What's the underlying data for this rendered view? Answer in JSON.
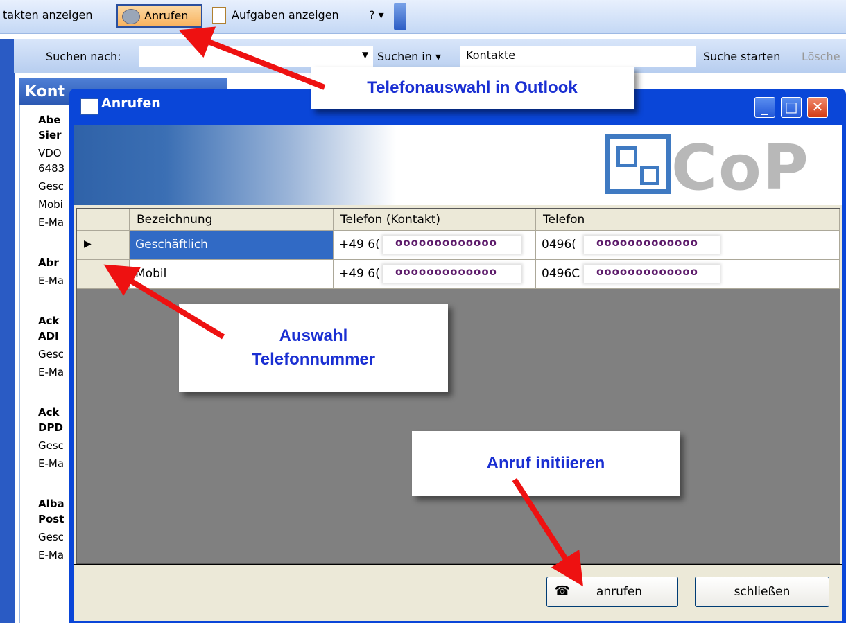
{
  "toolbar": {
    "show_contacts": "takten anzeigen",
    "call": "Anrufen",
    "show_tasks": "Aufgaben anzeigen",
    "help": "?"
  },
  "search": {
    "label": "Suchen nach:",
    "search_in": "Suchen in",
    "scope": "Kontakte",
    "start": "Suche starten",
    "clear": "Lösche"
  },
  "contacts": {
    "header": "Kont",
    "entries": [
      {
        "l1": "Abe",
        "l2": "Sier",
        "l3": "VDO",
        "l4": "6483",
        "l5": "Gesc",
        "l6": "Mobi",
        "l7": "E-Ma"
      },
      {
        "l1": "Abr",
        "l2": "E-Ma"
      },
      {
        "l1": "Ack",
        "l2": "ADI",
        "l3": "Gesc",
        "l4": "E-Ma"
      },
      {
        "l1": "Ack",
        "l2": "DPD",
        "l3": "Gesc",
        "l4": "E-Ma"
      },
      {
        "l1": "Alba",
        "l2": "Post",
        "l3": "Gesc",
        "l4": "E-Ma"
      }
    ]
  },
  "dialog": {
    "title": "Anrufen",
    "logo": "CoP",
    "columns": [
      "Bezeichnung",
      "Telefon (Kontakt)",
      "Telefon"
    ],
    "rows": [
      {
        "label": "Geschäftlich",
        "phone_contact": "+49 6(",
        "phone": "0496(",
        "mask": "ooooooooooooo"
      },
      {
        "label": "Mobil",
        "phone_contact": "+49 6(",
        "phone": "0496C",
        "mask": "ooooooooooooo"
      }
    ],
    "call_button": "anrufen",
    "close_button": "schließen"
  },
  "annotations": {
    "phone_select_outlook": "Telefonauswahl in Outlook",
    "select_number_1": "Auswahl",
    "select_number_2": "Telefonnummer",
    "initiate_call": "Anruf initiieren"
  },
  "colors": {
    "annotation_text": "#1a2fd2",
    "arrow": "#ee1111",
    "selection": "#316ac5",
    "title_bar": "#0a46d8"
  }
}
